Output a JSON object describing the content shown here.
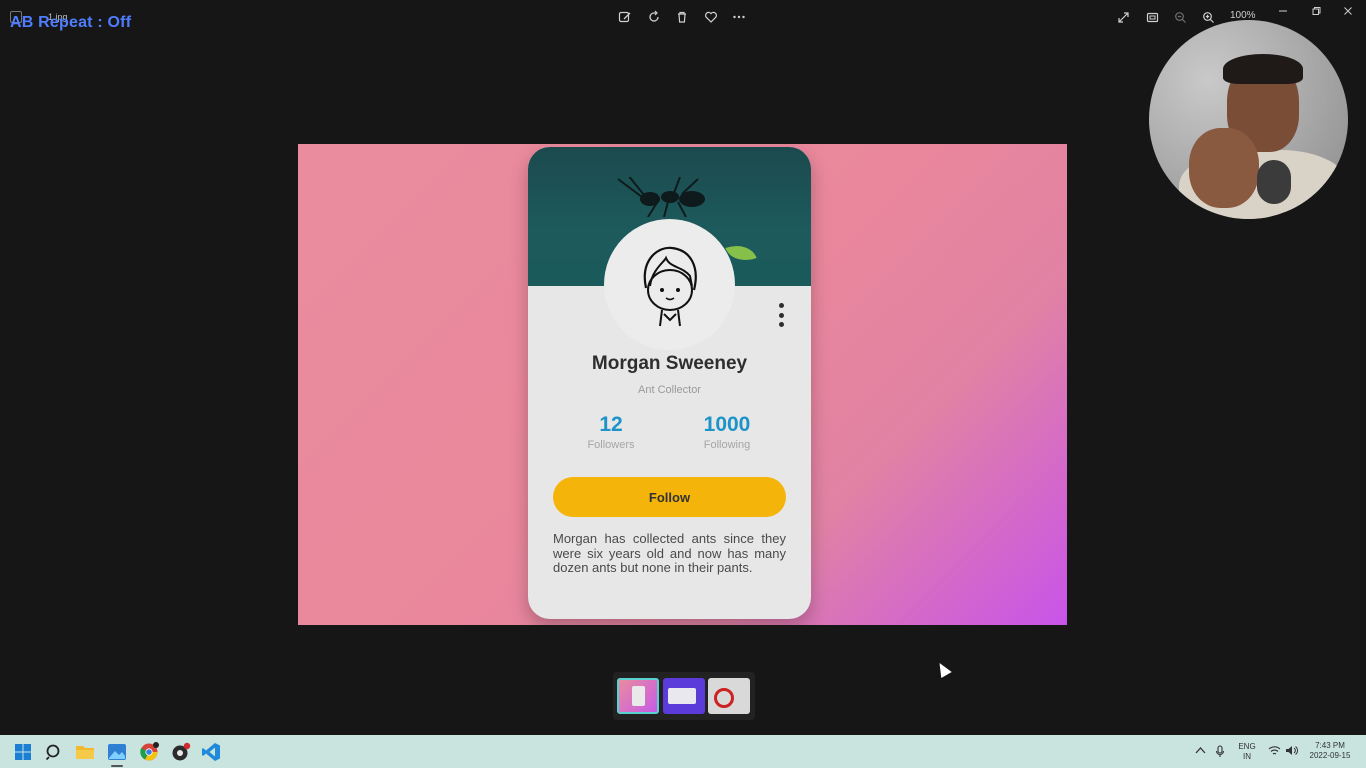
{
  "window": {
    "file_name": "1.jpg",
    "overlay_text": "AB Repeat : Off",
    "zoom": "100%"
  },
  "toolbar": {
    "icons": [
      "edit-image-icon",
      "rotate-icon",
      "delete-icon",
      "favorite-icon",
      "more-icon"
    ],
    "right_icons": [
      "expand-icon",
      "fit-screen-icon",
      "zoom-out-icon",
      "zoom-in-icon"
    ]
  },
  "profile_card": {
    "name": "Morgan Sweeney",
    "role": "Ant Collector",
    "stats": [
      {
        "value": "12",
        "label": "Followers"
      },
      {
        "value": "1000",
        "label": "Following"
      }
    ],
    "button_label": "Follow",
    "bio": "Morgan has collected ants since they were six years old and now has many dozen ants but none in their pants."
  },
  "colors": {
    "accent_button": "#f5b40a",
    "stat_number": "#1d93c9",
    "gradient_start": "#eb8c9e",
    "gradient_end": "#c854e9",
    "banner": "#1b4a4e"
  },
  "taskbar": {
    "apps": [
      "windows-start-icon",
      "search-icon",
      "file-explorer-icon",
      "photos-icon",
      "chrome-icon",
      "app-icon",
      "vscode-icon"
    ],
    "tray": {
      "language_top": "ENG",
      "language_bottom": "IN",
      "time": "7:43 PM",
      "date": "2022-09-15"
    }
  }
}
